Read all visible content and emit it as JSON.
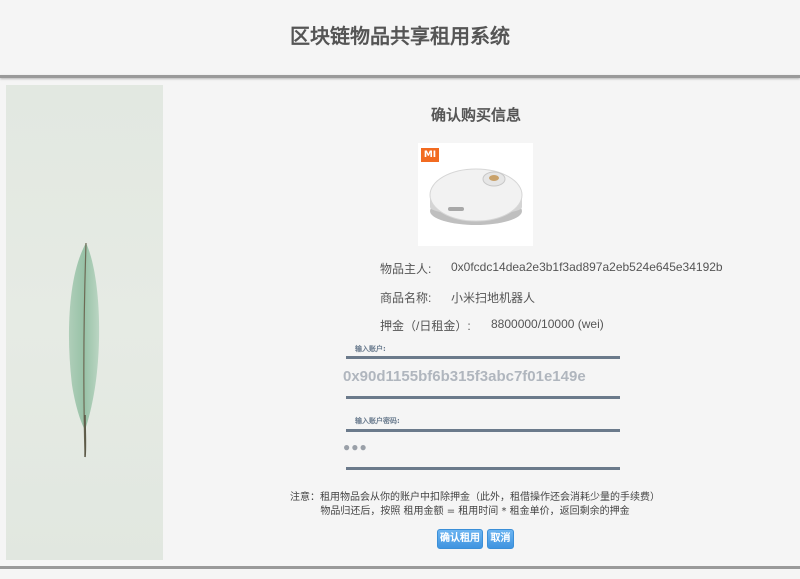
{
  "header": {
    "title": "区块链物品共享租用系统"
  },
  "side_image": {
    "alt": "feather"
  },
  "panel": {
    "title": "确认购买信息"
  },
  "product_image": {
    "logo_text": "MI",
    "alt": "robot vacuum"
  },
  "info": {
    "owner_label": "物品主人:",
    "owner_value": "0x0fcdc14dea2e3b1f3ad897a2eb524e645e34192b",
    "name_label": "商品名称:",
    "name_value": "小米扫地机器人",
    "deposit_label": "押金（/日租金）:",
    "deposit_value": "8800000/10000 (wei)"
  },
  "form": {
    "account_label": "输入账户:",
    "account_value": "0x90d1155bf6b315f3abc7f01e149e",
    "password_label": "输入账户密码:",
    "password_value": "●●●"
  },
  "notes": {
    "line1": "注意：租用物品会从你的账户中扣除押金（此外，租借操作还会消耗少量的手续费）",
    "line2": "物品归还后，按照 租用金额 = 租用时间 * 租金单价，返回剩余的押金"
  },
  "buttons": {
    "confirm": "确认租用",
    "cancel": "取消"
  },
  "colors": {
    "button": "#4a9be4",
    "line": "#6b7a8b",
    "logo": "#f26b21"
  }
}
